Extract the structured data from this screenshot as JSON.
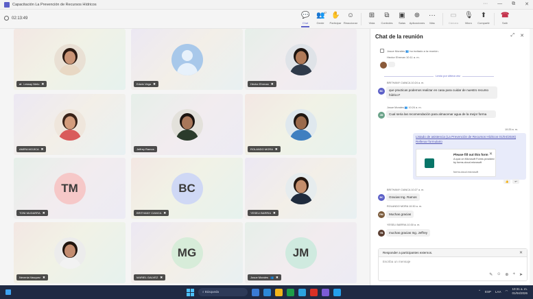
{
  "window": {
    "title": "Capacitación La Prevención de Recursos Hídricos",
    "controls": [
      "···",
      "—",
      "⧉",
      "✕"
    ]
  },
  "meeting": {
    "elapsed": "02:13:49"
  },
  "toolbar": {
    "items": [
      {
        "label": "Chat",
        "icon": "💬",
        "state": "active"
      },
      {
        "label": "Gente",
        "icon": "👥",
        "state": "normal"
      },
      {
        "label": "Participar",
        "icon": "✋",
        "state": "normal"
      },
      {
        "label": "Reaccionar",
        "icon": "☺",
        "state": "normal"
      },
      {
        "label": "Vista",
        "icon": "⊞",
        "state": "normal"
      },
      {
        "label": "Controles",
        "icon": "⧉",
        "state": "normal"
      },
      {
        "label": "Salas",
        "icon": "▣",
        "state": "normal"
      },
      {
        "label": "Aplicaciones",
        "icon": "⊕",
        "state": "normal"
      },
      {
        "label": "Más",
        "icon": "···",
        "state": "normal"
      },
      {
        "label": "Cámara",
        "icon": "▭",
        "state": "dim"
      },
      {
        "label": "Micro",
        "icon": "🎙",
        "state": "normal"
      },
      {
        "label": "Compartir",
        "icon": "⬆",
        "state": "normal"
      },
      {
        "label": "Salir",
        "icon": "☎",
        "state": "leave"
      }
    ],
    "people_count": "47"
  },
  "participants": [
    {
      "name": "Lessay Nieto",
      "type": "photo",
      "skin": "#c99476",
      "hair": "#2b1a12",
      "shirt": "#e8d8c4",
      "bg": "#e9e0d4",
      "mic": true,
      "prefix": "⇄"
    },
    {
      "name": "Edwin Vega",
      "type": "blank",
      "mic": true
    },
    {
      "name": "Hector Ehrman",
      "type": "photo",
      "skin": "#b07a58",
      "hair": "#1c1410",
      "shirt": "#2f3a4a",
      "bg": "#dfe3e8",
      "mic": true
    },
    {
      "name": "AMIRA MOJICA",
      "type": "photo",
      "skin": "#d39c7c",
      "hair": "#3a2318",
      "shirt": "#d95b5b",
      "bg": "#efe6dc",
      "mic": true
    },
    {
      "name": "Jeffrey Ramos",
      "type": "photo",
      "skin": "#a8775a",
      "hair": "#1b1410",
      "shirt": "#2b3b2b",
      "bg": "#e3e1db",
      "mic": false
    },
    {
      "name": "ROLANDO MORA",
      "type": "photo",
      "skin": "#9b6a4c",
      "hair": "#1e1612",
      "shirt": "#3f7fc0",
      "bg": "#dfe8ee",
      "mic": true
    },
    {
      "name": "TONI MUDARRA",
      "type": "initials",
      "initials": "TM",
      "color": "#f6c8c8",
      "mic": true
    },
    {
      "name": "BRITHANY CIANCA",
      "type": "initials",
      "initials": "BC",
      "color": "#cfd8f5",
      "mic": true
    },
    {
      "name": "YESELI BARRIA",
      "type": "photo",
      "skin": "#c48e6c",
      "hair": "#24160f",
      "shirt": "#1f2b3d",
      "bg": "#e6ecee",
      "mic": true
    },
    {
      "name": "Nevenia Vasquez",
      "type": "photo",
      "skin": "#c38c70",
      "hair": "#1f140e",
      "shirt": "#f2f2f2",
      "bg": "#ececec",
      "mic": true
    },
    {
      "name": "MARIEL GALVEZ",
      "type": "initials",
      "initials": "MG",
      "color": "#d7ecd9",
      "mic": true
    },
    {
      "name": "Josue Morales",
      "type": "initials",
      "initials": "JM",
      "color": "#cfeadf",
      "mic": true,
      "suffix": "👥"
    }
  ],
  "chat": {
    "title": "Chat de la reunión",
    "head_icons": [
      "⤢",
      "✕"
    ],
    "system_event": "Josue Morales 👥 ha invitado a la reunión.",
    "system_event2": "Hector Ehrman 10:11 a. m.",
    "unread_label": "Leído por última vez",
    "messages": [
      {
        "author": "BRITHANY CIANCA",
        "time": "10:24 a. m.",
        "initials": "BC",
        "color": "#5b5fc7",
        "text": "que practicas podemos realizar en casa para cuidar de nuestro recurso hídrico?"
      },
      {
        "author": "Josue Morales 👥",
        "time": "10:24 a. m.",
        "initials": "JM",
        "color": "#6aa389",
        "text": "Cual seria las recomendación para almacenar agua de la mejor forma"
      },
      {
        "author": "BRITHANY CIANCA",
        "time": "10:27 a. m.",
        "initials": "BC",
        "color": "#5b5fc7",
        "text": "Gracias Ing. Ramos"
      },
      {
        "author": "ROLANDO MORA",
        "time": "10:30 a. m.",
        "initials": "RM",
        "color": "#7a5a3a",
        "text": "Muchas gracias"
      },
      {
        "author": "YESELI BARRIA",
        "time": "10:30 a. m.",
        "initials": "YB",
        "color": "#5a3d30",
        "text": "muchas gracias Ing. Jeffrey"
      }
    ],
    "my_message": {
      "time": "10:25 a. m.",
      "link_text": "Listado de asistencia (La Prevención de Recursos Hídricos 01/04/2026) Rellenar formulario",
      "card_title": "Please fill out this form",
      "card_desc": "A quiz on Microsoft Forms provided by forms.cloud.microsoft",
      "card_domain": "forms.cloud.microsoft",
      "reactions": [
        "👍",
        "↩"
      ]
    },
    "compose": {
      "external_notice": "Responder a participantes externos.",
      "placeholder": "Escriba un mensaje",
      "actions": [
        "✎",
        "☺",
        "⊕",
        "+",
        "➤"
      ]
    }
  },
  "taskbar": {
    "search_label": "Búsqueda",
    "apps": [
      "#3a7bd5",
      "#2b88d8",
      "#f3b51b",
      "#1e9e4a",
      "#2ba3e0",
      "#d93025",
      "#7c5cd6",
      "#24a0ed"
    ],
    "tray_lang": "ESP",
    "tray_region": "LAA",
    "time": "10:31 a. m.",
    "date": "01/04/2026"
  }
}
